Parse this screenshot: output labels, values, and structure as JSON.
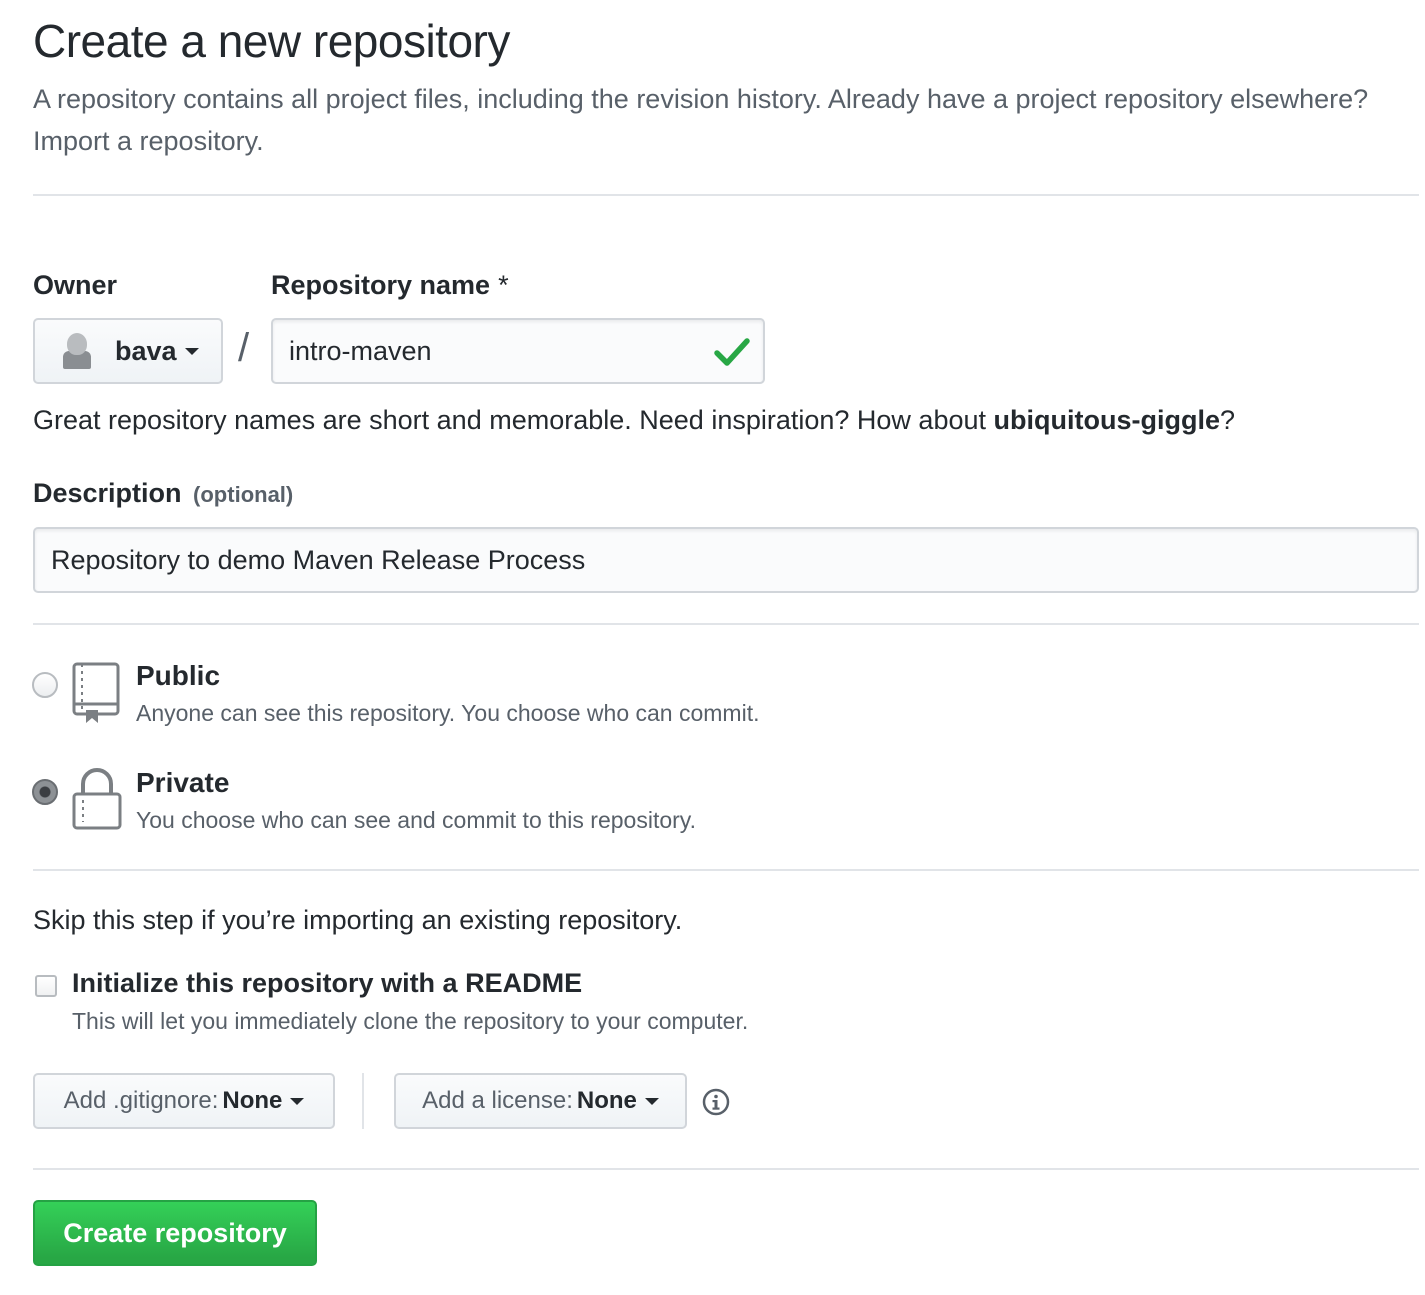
{
  "header": {
    "title": "Create a new repository",
    "subtitle_text": "A repository contains all project files, including the revision history. Already have a project repository elsewhere?",
    "import_link": "Import a repository."
  },
  "owner": {
    "label": "Owner",
    "value": "bava"
  },
  "repo_name": {
    "label": "Repository name",
    "required_marker": "*",
    "value": "intro-maven",
    "valid": true,
    "separator": "/"
  },
  "name_hint": {
    "text": "Great repository names are short and memorable. Need inspiration? How about",
    "suggestion": "ubiquitous-giggle",
    "suffix": "?"
  },
  "description": {
    "label": "Description",
    "optional_note": "(optional)",
    "value": "Repository to demo Maven Release Process"
  },
  "visibility": {
    "options": [
      {
        "title": "Public",
        "description": "Anyone can see this repository. You choose who can commit.",
        "icon": "repo-icon",
        "checked": false
      },
      {
        "title": "Private",
        "description": "You choose who can see and commit to this repository.",
        "icon": "lock-icon",
        "checked": true
      }
    ]
  },
  "init": {
    "skip_text": "Skip this step if you’re importing an existing repository.",
    "readme_label": "Initialize this repository with a README",
    "readme_desc": "This will let you immediately clone the repository to your computer.",
    "readme_checked": false
  },
  "gitignore": {
    "label": "Add .gitignore:",
    "value": "None"
  },
  "license": {
    "label": "Add a license:",
    "value": "None"
  },
  "submit": {
    "label": "Create repository"
  },
  "colors": {
    "primary_green": "#28a745",
    "text": "#24292e",
    "muted": "#586069",
    "border": "#d1d5da"
  }
}
